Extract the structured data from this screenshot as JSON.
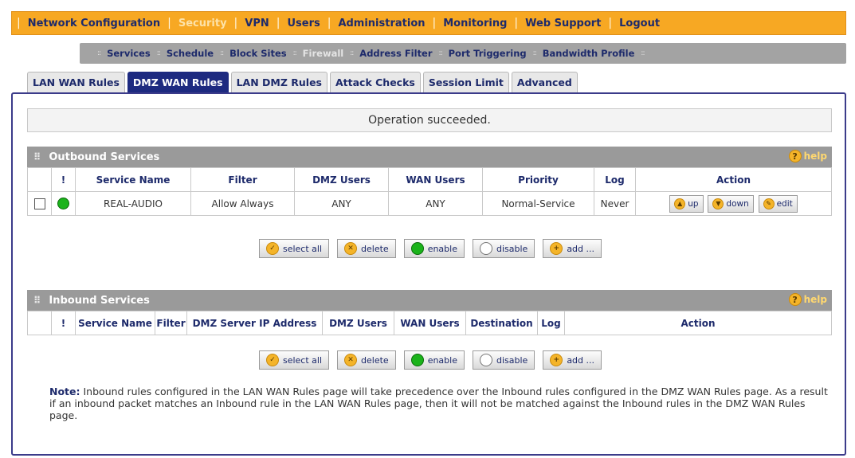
{
  "topnav": {
    "items": [
      "Network Configuration",
      "Security",
      "VPN",
      "Users",
      "Administration",
      "Monitoring",
      "Web Support",
      "Logout"
    ],
    "active": "Security"
  },
  "subnav": {
    "items": [
      "Services",
      "Schedule",
      "Block Sites",
      "Firewall",
      "Address Filter",
      "Port Triggering",
      "Bandwidth Profile"
    ],
    "active": "Firewall"
  },
  "tabs": {
    "items": [
      "LAN WAN Rules",
      "DMZ WAN Rules",
      "LAN DMZ Rules",
      "Attack Checks",
      "Session Limit",
      "Advanced"
    ],
    "active": "DMZ WAN Rules"
  },
  "status": "Operation succeeded.",
  "outbound": {
    "title": "Outbound Services",
    "help": "help",
    "columns": [
      "!",
      "Service Name",
      "Filter",
      "DMZ Users",
      "WAN Users",
      "Priority",
      "Log",
      "Action"
    ],
    "rows": [
      {
        "service_name": "REAL-AUDIO",
        "filter": "Allow Always",
        "dmz_users": "ANY",
        "wan_users": "ANY",
        "priority": "Normal-Service",
        "log": "Never",
        "actions": [
          "up",
          "down",
          "edit"
        ]
      }
    ]
  },
  "inbound": {
    "title": "Inbound Services",
    "help": "help",
    "columns": [
      "!",
      "Service Name",
      "Filter",
      "DMZ Server IP Address",
      "DMZ Users",
      "WAN Users",
      "Destination",
      "Log",
      "Action"
    ]
  },
  "buttons": {
    "select_all": "select all",
    "delete": "delete",
    "enable": "enable",
    "disable": "disable",
    "add": "add ..."
  },
  "note": {
    "label": "Note:",
    "text": "Inbound rules configured in the LAN WAN Rules page will take precedence over the Inbound rules configured in the DMZ WAN Rules page. As a result if an inbound packet matches an Inbound rule in the LAN WAN Rules page, then it will not be matched against the Inbound rules in the DMZ WAN Rules page."
  },
  "colors": {
    "nav_orange": "#f7a823",
    "nav_text": "#1d2a6b",
    "tab_active": "#1d2a80",
    "section_grey": "#9a9a9a",
    "status_green": "#1bb31b"
  }
}
